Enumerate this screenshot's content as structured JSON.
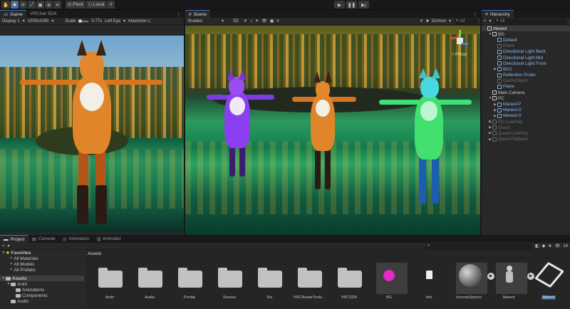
{
  "toolbar": {
    "pivot_label": "Pivot",
    "local_label": "Local"
  },
  "game": {
    "tabs": [
      {
        "label": "Game"
      },
      {
        "label": "VRChat SDK"
      }
    ],
    "display": "Display 1",
    "resolution": "1000x1000",
    "scale_label": "Scale",
    "scale_value": "0.77x",
    "eye": "Left Eye",
    "maximize": "Maximize C"
  },
  "scene": {
    "tab": "Scene",
    "shading": "Shaded",
    "mode_2d": "2D",
    "gizmos": "Gizmos",
    "search_prefix": "All",
    "persp": "< Persp"
  },
  "hierarchy": {
    "tab": "Hierarchy",
    "search_prefix": "All",
    "items": [
      {
        "label": "Maned",
        "indent": 0,
        "kind": "root"
      },
      {
        "label": "BG",
        "indent": 1,
        "kind": "normal",
        "arrow": "▼"
      },
      {
        "label": "Default",
        "indent": 2,
        "kind": "prefab"
      },
      {
        "label": "Plane",
        "indent": 2,
        "kind": "dim"
      },
      {
        "label": "Directional Light Back",
        "indent": 2,
        "kind": "prefab"
      },
      {
        "label": "Directional Light Mid",
        "indent": 2,
        "kind": "prefab"
      },
      {
        "label": "Directional Light Front",
        "indent": 2,
        "kind": "prefab"
      },
      {
        "label": "BG2",
        "indent": 2,
        "kind": "prefab",
        "arrow": "▶"
      },
      {
        "label": "Reflection Probe",
        "indent": 2,
        "kind": "prefab"
      },
      {
        "label": "GameObject",
        "indent": 2,
        "kind": "dim"
      },
      {
        "label": "Plane",
        "indent": 2,
        "kind": "prefab"
      },
      {
        "label": "Main Camera",
        "indent": 1,
        "kind": "normal"
      },
      {
        "label": "PC",
        "indent": 1,
        "kind": "normal",
        "arrow": "▼"
      },
      {
        "label": "Maned-P",
        "indent": 2,
        "kind": "prefab",
        "arrow": "▶"
      },
      {
        "label": "Maned-O",
        "indent": 2,
        "kind": "prefab",
        "arrow": "▶"
      },
      {
        "label": "Maned-G",
        "indent": 2,
        "kind": "prefab",
        "arrow": "▶"
      },
      {
        "label": "PC-LowPoly",
        "indent": 1,
        "kind": "dim",
        "arrow": "▶"
      },
      {
        "label": "Quest",
        "indent": 1,
        "kind": "dim",
        "arrow": "▶"
      },
      {
        "label": "Quest-LowPoly",
        "indent": 1,
        "kind": "dim",
        "arrow": "▶"
      },
      {
        "label": "Quest-Fallback",
        "indent": 1,
        "kind": "dim",
        "arrow": "▶"
      }
    ]
  },
  "project": {
    "tabs": [
      {
        "label": "Project"
      },
      {
        "label": "Console"
      },
      {
        "label": "Animation"
      },
      {
        "label": "Animator"
      }
    ],
    "breadcrumb": "Assets",
    "count": "14",
    "favorites_label": "Favorites",
    "favorites": [
      {
        "label": "All Materials"
      },
      {
        "label": "All Models"
      },
      {
        "label": "All Prefabs"
      }
    ],
    "tree": [
      {
        "label": "Assets",
        "indent": 0,
        "arrow": "▼"
      },
      {
        "label": "Anim",
        "indent": 1,
        "arrow": "▼"
      },
      {
        "label": "Animations",
        "indent": 2
      },
      {
        "label": "Components",
        "indent": 2
      },
      {
        "label": "Audio",
        "indent": 1
      }
    ],
    "assets": [
      {
        "label": "Anim",
        "type": "folder"
      },
      {
        "label": "Audio",
        "type": "folder"
      },
      {
        "label": "Prefab",
        "type": "folder"
      },
      {
        "label": "Scenes",
        "type": "folder"
      },
      {
        "label": "Tex",
        "type": "folder"
      },
      {
        "label": "VRCAvatarTools...",
        "type": "folder"
      },
      {
        "label": "VRCSDK",
        "type": "folder"
      },
      {
        "label": "BG",
        "type": "material"
      },
      {
        "label": "Info",
        "type": "file"
      },
      {
        "label": "InverseSphere",
        "type": "model"
      },
      {
        "label": "Maned",
        "type": "avatar"
      },
      {
        "label": "Maned",
        "type": "unity"
      }
    ]
  }
}
